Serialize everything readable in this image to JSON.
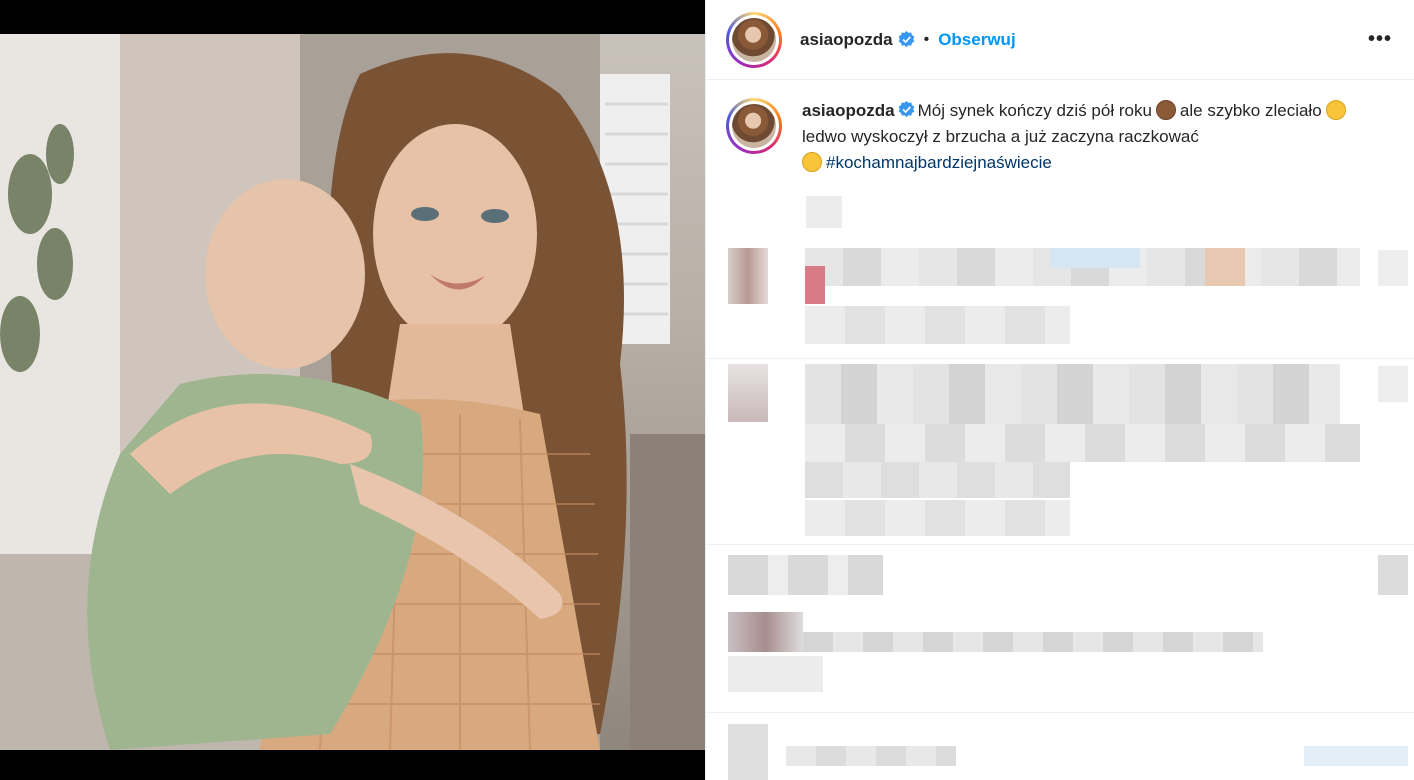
{
  "post": {
    "username": "asiaopozda",
    "follow_label": "Obserwuj",
    "more_label": "•••",
    "dot": "•"
  },
  "caption": {
    "username": "asiaopozda",
    "text_1": "Mój synek kończy dziś pół roku",
    "text_2": "ale szybko zleciało",
    "text_3": "ledwo wyskoczył z brzucha a już zaczyna raczkować",
    "hashtag": "#kochamnajbardziejnaświecie"
  },
  "icons": {
    "verified": "verified-badge-icon",
    "monkey": "see-no-evil-monkey-emoji",
    "smile": "smiling-face-emoji",
    "grin": "grinning-face-emoji"
  },
  "colors": {
    "link": "#0095f6",
    "hashtag": "#00376b",
    "text": "#262626"
  }
}
